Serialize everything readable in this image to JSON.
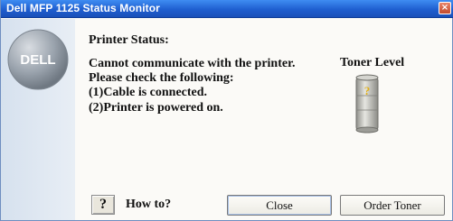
{
  "window": {
    "title": "Dell MFP 1125 Status Monitor",
    "close_glyph": "×"
  },
  "logo": {
    "text": "DELL"
  },
  "status": {
    "heading": "Printer Status:",
    "lines": [
      "Cannot communicate with the printer.",
      "Please check the following:",
      "(1)Cable is connected.",
      "(2)Printer is powered on."
    ]
  },
  "toner": {
    "label": "Toner Level",
    "unknown_glyph": "?"
  },
  "footer": {
    "help_glyph": "?",
    "howto_label": "How to?",
    "close_label": "Close",
    "order_label": "Order Toner"
  },
  "colors": {
    "titlebar": "#1f5fd0",
    "logo_fill": "#9aa3ad",
    "toner_body": "#b7b7b2",
    "toner_question": "#e2b018"
  },
  "icons": [
    "dell-logo",
    "toner-cartridge-icon",
    "help-icon",
    "window-close-icon"
  ]
}
